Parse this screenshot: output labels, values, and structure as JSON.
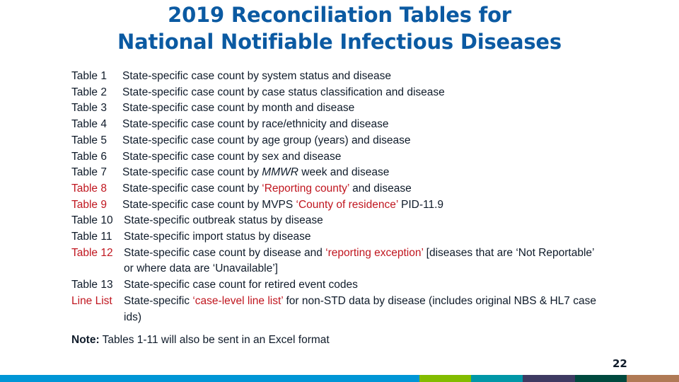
{
  "slide": {
    "title_lines": [
      "2019 Reconciliation Tables for",
      "National Notifiable Infectious Diseases"
    ],
    "rows": [
      {
        "label": "Table 1",
        "parts": [
          {
            "text": "State-specific case count by system status and disease"
          }
        ]
      },
      {
        "label": "Table 2",
        "parts": [
          {
            "text": "State-specific case count by case status classification and disease"
          }
        ]
      },
      {
        "label": "Table 3",
        "parts": [
          {
            "text": "State-specific case count by month and disease"
          }
        ]
      },
      {
        "label": "Table 4",
        "parts": [
          {
            "text": "State-specific case count by race/ethnicity and disease"
          }
        ]
      },
      {
        "label": "Table 5",
        "parts": [
          {
            "text": "State-specific case count by age group (years) and disease"
          }
        ]
      },
      {
        "label": "Table 6",
        "parts": [
          {
            "text": "State-specific case count by sex and disease"
          }
        ]
      },
      {
        "label": "Table 7",
        "parts": [
          {
            "text": "State-specific case count by "
          },
          {
            "text": "MMWR",
            "italic": true
          },
          {
            "text": " week and disease"
          }
        ]
      },
      {
        "label": "Table 8",
        "label_red": true,
        "parts": [
          {
            "text": "State-specific case count by "
          },
          {
            "text": "‘Reporting county’",
            "red": true
          },
          {
            "text": " and disease"
          }
        ]
      },
      {
        "label": "Table 9",
        "label_red": true,
        "parts": [
          {
            "text": "State-specific case count by MVPS "
          },
          {
            "text": "‘County of residence’",
            "red": true
          },
          {
            "text": " PID-11.9"
          }
        ]
      },
      {
        "label": "Table 10",
        "parts": [
          {
            "text": "State-specific outbreak status by disease"
          }
        ]
      },
      {
        "label": "Table 11",
        "parts": [
          {
            "text": "State-specific import status by disease"
          }
        ]
      },
      {
        "label": "Table 12",
        "label_red": true,
        "parts": [
          {
            "text": "State-specific case count by disease and "
          },
          {
            "text": "‘reporting exception’",
            "red": true
          },
          {
            "text": " [diseases that are ‘Not Reportable’ or where data are ‘Unavailable’]"
          }
        ]
      },
      {
        "label": "Table 13",
        "parts": [
          {
            "text": "State-specific case count for retired event codes"
          }
        ]
      },
      {
        "label": "Line List",
        "label_red": true,
        "parts": [
          {
            "text": "State-specific "
          },
          {
            "text": "‘case-level line list’",
            "red": true
          },
          {
            "text": " for non-STD data by disease (includes original NBS & HL7 case ids)"
          }
        ]
      }
    ],
    "note": {
      "label": "Note:",
      "text": " Tables 1-11 will also be sent in an Excel format"
    },
    "page_number": "22"
  },
  "colors": {
    "title": "#0b5aa2",
    "highlight_red": "#c0161f",
    "footer_bar": [
      "#0096d6",
      "#82bc00",
      "#0097a7",
      "#3e3a62",
      "#00493e",
      "#b07a55"
    ]
  }
}
